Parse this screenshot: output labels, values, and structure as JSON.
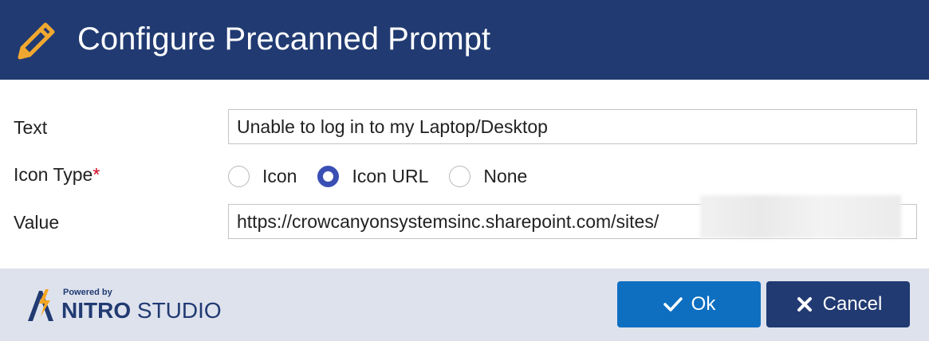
{
  "dialog": {
    "title": "Configure Precanned Prompt",
    "title_icon": "pencil-icon"
  },
  "form": {
    "text": {
      "label": "Text",
      "value": "Unable to log in to my Laptop/Desktop"
    },
    "icon_type": {
      "label": "Icon Type",
      "required_marker": "*",
      "options": [
        {
          "label": "Icon",
          "checked": false
        },
        {
          "label": "Icon URL",
          "checked": true
        },
        {
          "label": "None",
          "checked": false
        }
      ]
    },
    "value": {
      "label": "Value",
      "value": "https://crowcanyonsystemsinc.sharepoint.com/sites/"
    }
  },
  "footer": {
    "brand": {
      "powered_by": "Powered by",
      "name_bold": "NITRO",
      "name_regular": "STUDIO",
      "logo_icon": "nitro-logo-icon"
    },
    "ok_label": "Ok",
    "ok_icon": "checkmark-icon",
    "cancel_label": "Cancel",
    "cancel_icon": "x-icon"
  },
  "colors": {
    "titlebar": "#213a72",
    "footer": "#dde2ed",
    "ok_button": "#0e6fc1",
    "cancel_button": "#213a72",
    "radio_checked": "#3a4fb4",
    "pencil_icon": "#f0a830",
    "required": "#d0021b"
  }
}
